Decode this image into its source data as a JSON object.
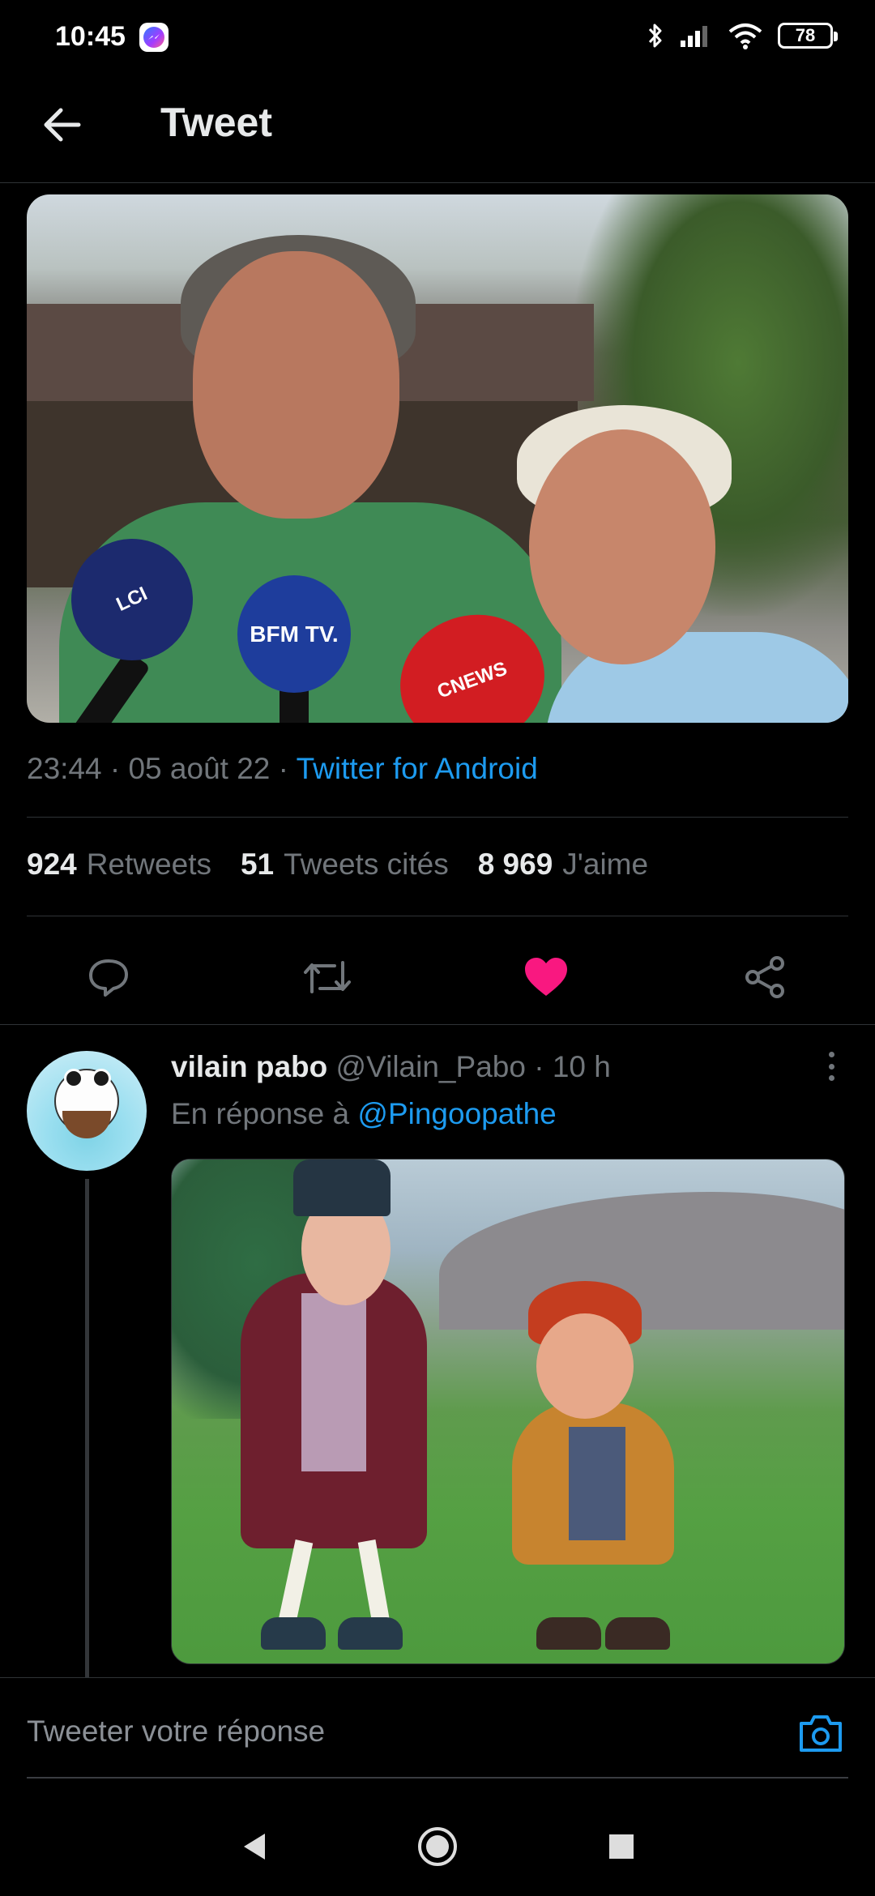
{
  "status_bar": {
    "time": "10:45",
    "notification_icon": "messenger-icon",
    "icons": [
      "bluetooth-icon",
      "signal-icon",
      "wifi-icon"
    ],
    "battery": "78"
  },
  "header": {
    "back_icon": "arrow-left-icon",
    "title": "Tweet"
  },
  "tweet": {
    "media_text": {
      "mic1": "LCI",
      "mic2": "BFM TV.",
      "mic3": "CNEWS"
    },
    "time": "23:44",
    "separator": "·",
    "date": "05 août 22",
    "source": "Twitter for Android",
    "stats": {
      "retweets_count": "924",
      "retweets_label": "Retweets",
      "quotes_count": "51",
      "quotes_label": "Tweets cités",
      "likes_count": "8 969",
      "likes_label": "J'aime"
    },
    "actions": {
      "reply_icon": "reply-icon",
      "retweet_icon": "retweet-icon",
      "like_icon": "heart-filled-icon",
      "share_icon": "share-icon"
    },
    "liked_color": "#f91880"
  },
  "reply": {
    "name": "vilain pabo",
    "handle": "@Vilain_Pabo",
    "separator": "·",
    "age": "10 h",
    "reply_prefix": "En réponse à",
    "reply_handle": "@Pingoopathe",
    "more_icon": "more-vertical-icon"
  },
  "composer": {
    "placeholder": "Tweeter votre réponse",
    "camera_icon": "camera-icon"
  },
  "nav": {
    "back_icon": "nav-back-icon",
    "home_icon": "nav-home-icon",
    "recents_icon": "nav-recents-icon"
  },
  "colors": {
    "background": "#000000",
    "accent": "#1d9bf0",
    "secondary_text": "#71767b"
  }
}
